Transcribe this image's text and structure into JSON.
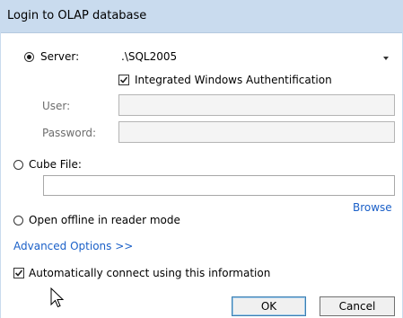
{
  "window": {
    "title": "Login to OLAP database"
  },
  "server": {
    "label": "Server:",
    "value": ".\\SQL2005",
    "selected": true
  },
  "integrated_auth": {
    "label": "Integrated Windows Authentification",
    "checked": true
  },
  "user": {
    "label": "User:",
    "value": ""
  },
  "password": {
    "label": "Password:",
    "value": ""
  },
  "cube_file": {
    "label": "Cube File:",
    "value": "",
    "selected": false
  },
  "browse": {
    "label": "Browse"
  },
  "offline": {
    "label": "Open offline in reader mode",
    "selected": false
  },
  "advanced": {
    "label": "Advanced Options >>"
  },
  "auto_connect": {
    "label": "Automatically connect using this information",
    "checked": true
  },
  "buttons": {
    "ok": "OK",
    "cancel": "Cancel"
  },
  "colors": {
    "accent": "#1b60c8",
    "titlebar": "#c9dbee"
  }
}
